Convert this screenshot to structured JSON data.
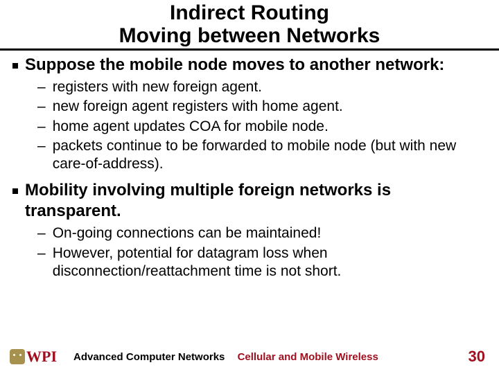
{
  "title": {
    "line1": "Indirect Routing",
    "line2": "Moving between Networks"
  },
  "bullets": [
    {
      "text": "Suppose the mobile node moves to another network:",
      "sub": [
        "registers with new foreign agent.",
        "new foreign agent registers with home agent.",
        "home agent updates COA for mobile node.",
        "packets continue to be forwarded to mobile node (but with new care-of-address)."
      ]
    },
    {
      "text": "Mobility involving multiple foreign networks is transparent.",
      "sub": [
        "On-going connections can be maintained!",
        "However, potential for datagram loss when disconnection/reattachment time is not short."
      ]
    }
  ],
  "footer": {
    "logo_text": "WPI",
    "course": "Advanced Computer Networks",
    "topic": "Cellular and Mobile Wireless",
    "page": "30"
  }
}
